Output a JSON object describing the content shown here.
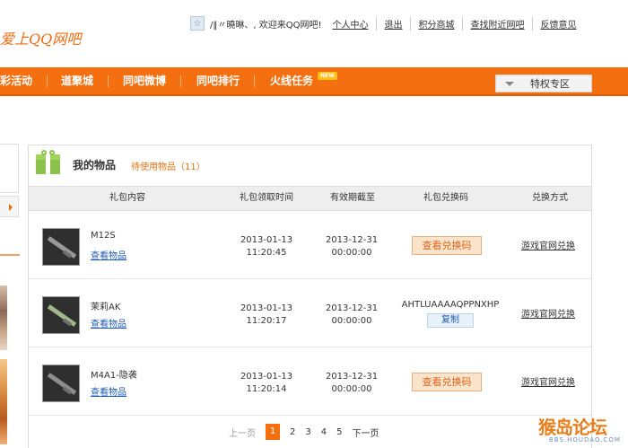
{
  "header": {
    "logo_text": "爱上QQ网吧",
    "welcome_icon": "star-icon",
    "welcome_text": "/‖〃曉晽、, 欢迎来QQ网吧!",
    "links": [
      "个人中心",
      "退出",
      "积分商城",
      "查找附近网吧",
      "反馈意见"
    ]
  },
  "nav": {
    "items": [
      "彩活动",
      "道聚城",
      "同吧微博",
      "同吧排行",
      "火线任务"
    ],
    "new_badge": "NEW",
    "privilege_label": "特权专区"
  },
  "panel": {
    "title": "我的物品",
    "subtitle": "待使用物品（11）",
    "columns": [
      "礼包内容",
      "礼包领取时间",
      "有效期截至",
      "礼包兑换码",
      "兑换方式"
    ],
    "rows": [
      {
        "name": "M12S",
        "view_label": "查看物品",
        "received_date": "2013-01-13",
        "received_time": "11:20:45",
        "expiry_date": "2013-12-31",
        "expiry_time": "00:00:00",
        "code_button": "查看兑换码",
        "code": "",
        "copy_label": "",
        "redeem": "游戏官网兑换",
        "weapon_color": "#9a9a9a"
      },
      {
        "name": "茉莉AK",
        "view_label": "查看物品",
        "received_date": "2013-01-13",
        "received_time": "11:20:17",
        "expiry_date": "2013-12-31",
        "expiry_time": "00:00:00",
        "code_button": "",
        "code": "AHTLUAAAAQPPNXHP",
        "copy_label": "复制",
        "redeem": "游戏官网兑换",
        "weapon_color": "#a1b78c"
      },
      {
        "name": "M4A1-隐袭",
        "view_label": "查看物品",
        "received_date": "2013-01-13",
        "received_time": "11:20:14",
        "expiry_date": "2013-12-31",
        "expiry_time": "00:00:00",
        "code_button": "查看兑换码",
        "code": "",
        "copy_label": "",
        "redeem": "游戏官网兑换",
        "weapon_color": "#8e8e8e"
      }
    ]
  },
  "pager": {
    "prev": "上一页",
    "pages": [
      "1",
      "2",
      "3",
      "4",
      "5"
    ],
    "current": "1",
    "next": "下一页"
  },
  "watermark": {
    "main": "猴岛论坛",
    "sub": "BBS.HOUDAO.COM"
  },
  "colors": {
    "accent": "#f46f10",
    "link": "#1f5bb0",
    "gift": "#8bc34a"
  }
}
